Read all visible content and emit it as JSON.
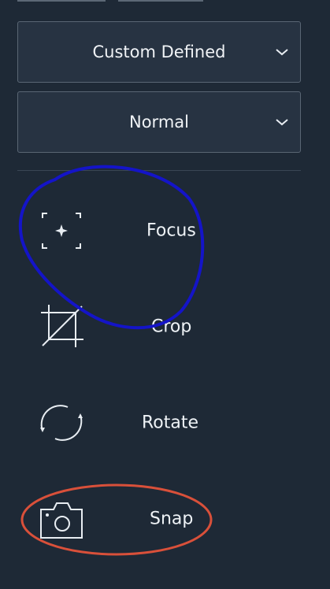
{
  "dropdowns": {
    "preset": {
      "value": "Custom Defined"
    },
    "mode": {
      "value": "Normal"
    }
  },
  "tools": [
    {
      "label": "Focus",
      "icon": "focus-icon"
    },
    {
      "label": "Crop",
      "icon": "crop-icon"
    },
    {
      "label": "Rotate",
      "icon": "rotate-icon"
    },
    {
      "label": "Snap",
      "icon": "camera-icon"
    }
  ],
  "colors": {
    "panel_background": "#1e2936",
    "dropdown_background": "#273342",
    "dropdown_border": "#5a6674",
    "text": "#eef2f6",
    "blue_annotation": "#1414c8",
    "red_annotation": "#d9503a"
  }
}
